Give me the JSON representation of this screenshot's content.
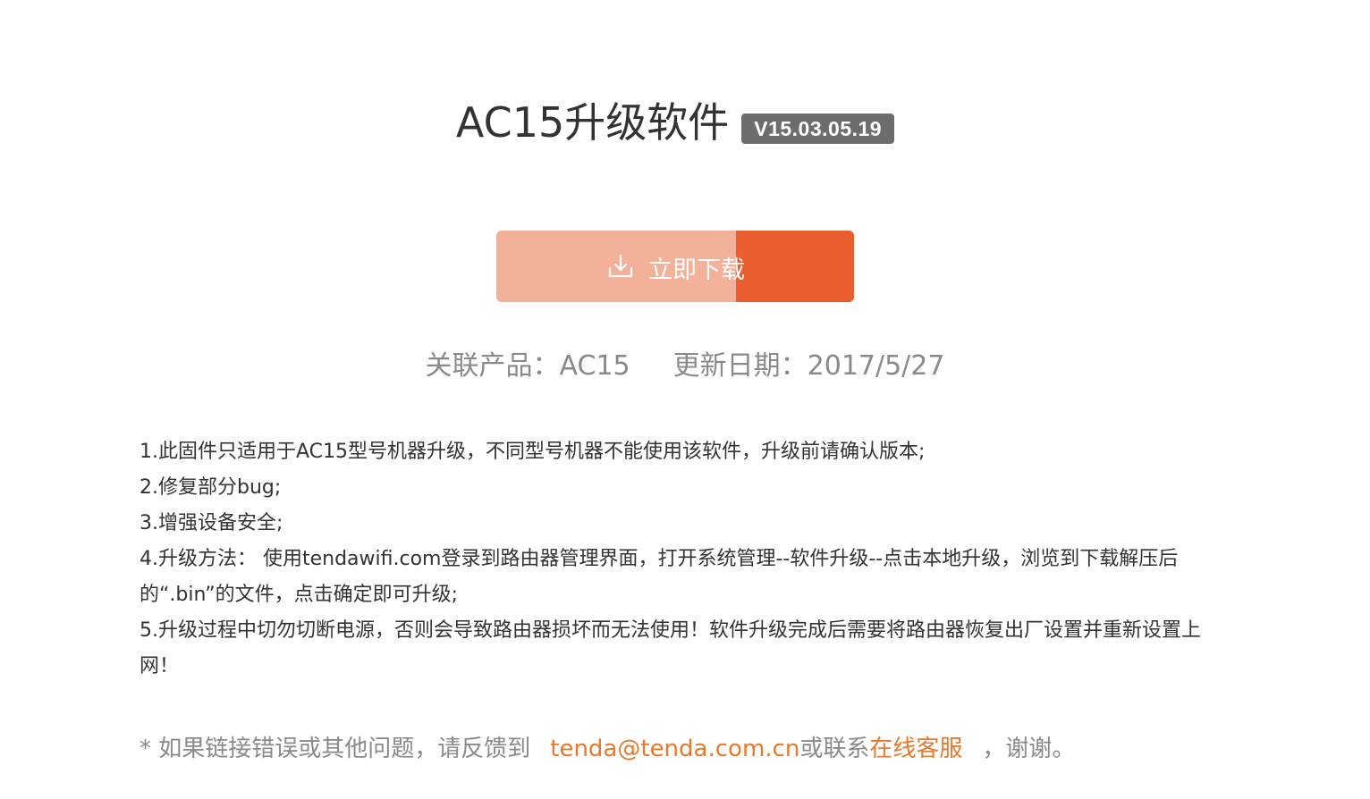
{
  "header": {
    "title": "AC15升级软件",
    "version": "V15.03.05.19"
  },
  "download": {
    "label": "立即下载",
    "icon": "download-icon",
    "progress_percent": 67,
    "colors": {
      "track": "#f4b199",
      "fill": "#e95d2e"
    }
  },
  "meta": {
    "product": "关联产品：AC15",
    "date": "更新日期：2017/5/27"
  },
  "notes": [
    "1.此固件只适用于AC15型号机器升级，不同型号机器不能使用该软件，升级前请确认版本;",
    "2.修复部分bug;",
    "3.增强设备安全;",
    "4.升级方法： 使用tendawifi.com登录到路由器管理界面，打开系统管理--软件升级--点击本地升级，浏览到下载解压后的“.bin”的文件，点击确定即可升级;",
    "5.升级过程中切勿切断电源，否则会导致路由器损坏而无法使用！软件升级完成后需要将路由器恢复出厂设置并重新设置上网！"
  ],
  "footer": {
    "prefix": "* 如果链接错误或其他问题，请反馈到",
    "email": "tenda@tenda.com.cn",
    "middle": "或联系",
    "service_link": "在线客服",
    "suffix": "，谢谢。"
  },
  "colors": {
    "link": "#e8792d",
    "muted_text": "#8a8a8a",
    "badge_bg": "#6d6d6d"
  }
}
